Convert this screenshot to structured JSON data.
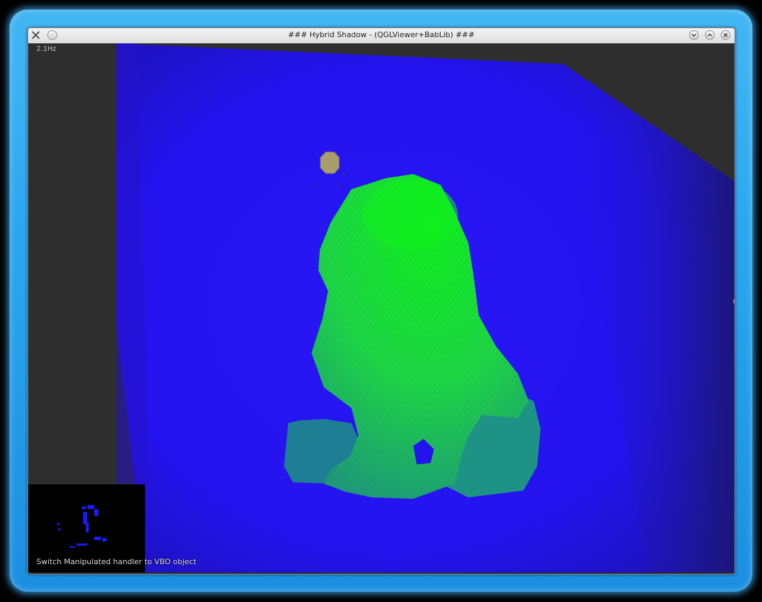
{
  "window": {
    "title": "### Hybrid Shadow - (QGLViewer+BabLib) ###",
    "icons": {
      "app": "qglviewer-app-icon",
      "menu": "window-menu-circle-icon",
      "minimize": "chevron-down-icon",
      "maximize": "chevron-up-icon",
      "close": "close-icon"
    }
  },
  "viewer": {
    "fps_label": "2.1Hz",
    "status_message": "Switch Manipulated handler to VBO object",
    "colors": {
      "background": "#2e2e2e",
      "ground_plane": "#2413f0",
      "model": "#1ee838",
      "light_marker": "#a79e6c",
      "shadow_map_bg": "#000000"
    }
  }
}
